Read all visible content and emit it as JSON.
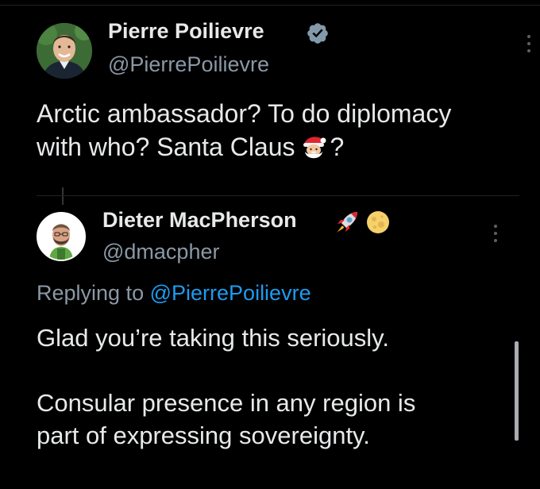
{
  "tweet": {
    "author_name": "Pierre Poilievre",
    "handle": "@PierrePoilievre",
    "verified": true,
    "text_line1": "Arctic ambassador? To do diplomacy",
    "text_line2_before": "with who? Santa Claus",
    "text_line2_after": "?",
    "emoji": "santa-claus"
  },
  "reply": {
    "author_name": "Dieter MacPherson",
    "handle": "@dmacpher",
    "name_emojis": [
      "rocket",
      "full-moon"
    ],
    "replying_prefix": "Replying to",
    "replying_mention": "@PierrePoilievre",
    "paragraph1": "Glad you’re taking this seriously.",
    "paragraph2_line1": "Consular presence in any region is",
    "paragraph2_line2": "part of expressing sovereignty."
  },
  "colors": {
    "background": "#000000",
    "text": "#e7e9ea",
    "secondary": "#8b98a5",
    "link": "#1d9bf0",
    "verified": "#829aab"
  },
  "icons": {
    "verified": "verified-badge-icon",
    "more": "more-options-icon"
  }
}
